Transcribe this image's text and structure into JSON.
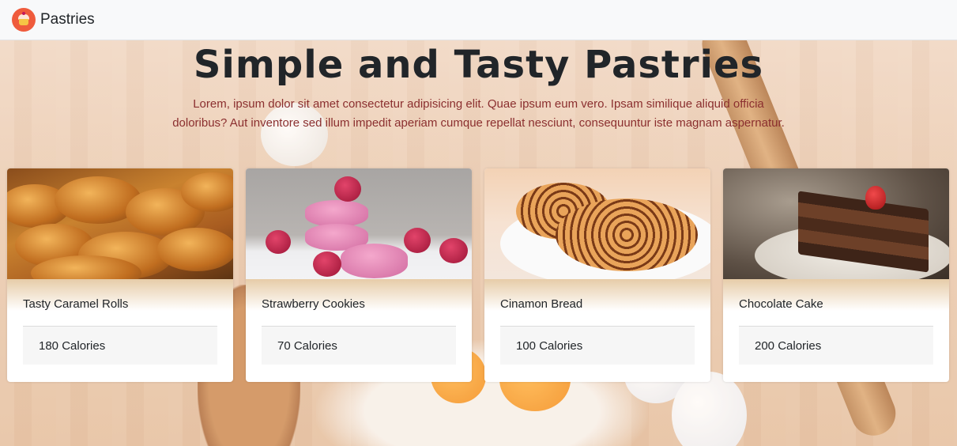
{
  "navbar": {
    "brand": "Pastries",
    "logo_icon": "cupcake-icon"
  },
  "hero": {
    "title": "Simple and Tasty Pastries",
    "text": "Lorem, ipsum dolor sit amet consectetur adipisicing elit. Quae ipsum eum vero. Ipsam similique aliquid officia doloribus? Aut inventore sed illum impedit aperiam cumque repellat nesciunt, consequuntur iste magnam aspernatur."
  },
  "cards": [
    {
      "title": "Tasty Caramel Rolls",
      "calories": "180 Calories",
      "image": "croissants"
    },
    {
      "title": "Strawberry Cookies",
      "calories": "70 Calories",
      "image": "macarons"
    },
    {
      "title": "Cinamon Bread",
      "calories": "100 Calories",
      "image": "cinnamon-rolls"
    },
    {
      "title": "Chocolate Cake",
      "calories": "200 Calories",
      "image": "chocolate-cake"
    }
  ],
  "colors": {
    "navbar_bg": "#f8f9fa",
    "logo": "#ef5b3c",
    "hero_text": "#8b2f2f",
    "card_footer_bg": "#f6f6f6"
  }
}
